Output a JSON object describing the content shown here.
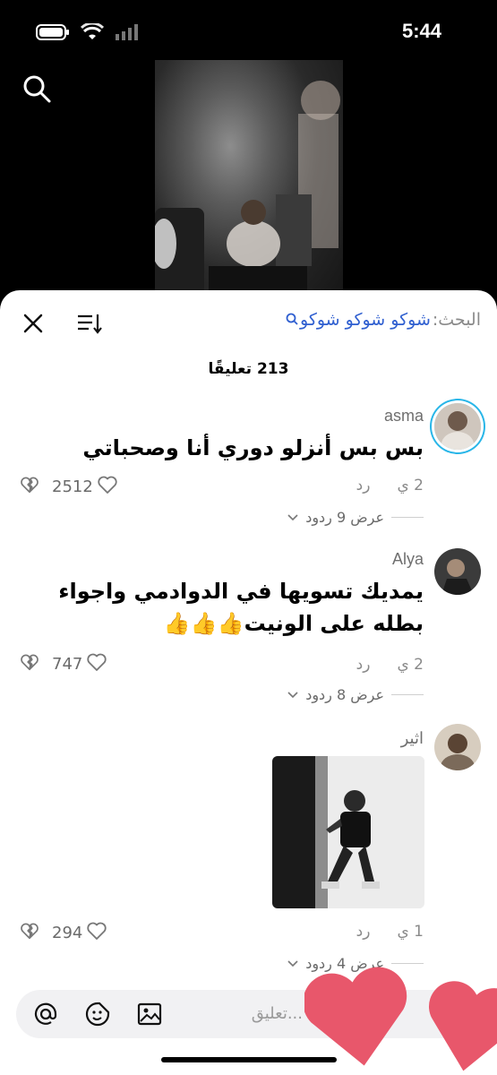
{
  "status_bar": {
    "time": "5:44"
  },
  "search": {
    "prefix": "البحث:",
    "term": "شوكو شوكو شوكو"
  },
  "comments_header": {
    "count_label": "213 تعليقًا"
  },
  "comments": [
    {
      "username": "asma",
      "text": "بس بس أنزلو دوري أنا وصحباتي",
      "age": "2 ي",
      "reply_label": "رد",
      "likes": "2512",
      "view_replies": "عرض 9 ردود"
    },
    {
      "username": "Alya",
      "text": "يمديك تسويها في الدوادمي واجواء بطله على الونيت👍👍👍",
      "age": "2 ي",
      "reply_label": "رد",
      "likes": "747",
      "view_replies": "عرض 8 ردود"
    },
    {
      "username": "اثير",
      "text": "",
      "age": "1 ي",
      "reply_label": "رد",
      "likes": "294",
      "view_replies": "عرض 4 ردود"
    }
  ],
  "input": {
    "placeholder": "...تعليق"
  },
  "colors": {
    "accent_blue": "#2f5fd0",
    "story_ring": "#29b6e8",
    "heart_red": "#e8576b"
  },
  "icons": [
    "search-icon",
    "close-icon",
    "sort-icon",
    "heart-outline-icon",
    "broken-heart-icon",
    "chevron-down-icon",
    "at-mention-icon",
    "emoji-icon",
    "image-icon"
  ]
}
